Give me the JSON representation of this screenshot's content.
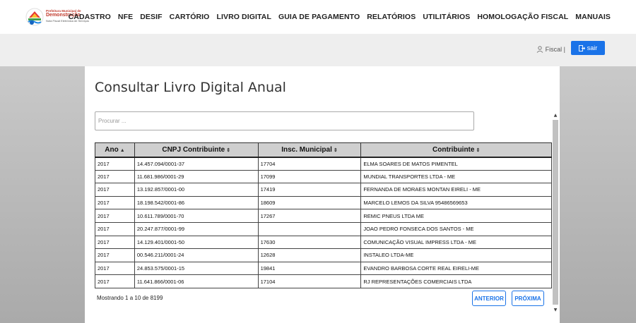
{
  "brand": {
    "line1": "Prefeitura Municipal de",
    "line2": "Demonstração",
    "line3": "Nota Fiscal Eletrônica de Serviços"
  },
  "nav": {
    "items": [
      "CADASTRO",
      "NFE",
      "DESIF",
      "CARTÓRIO",
      "LIVRO DIGITAL",
      "GUIA DE PAGAMENTO",
      "RELATÓRIOS",
      "UTILITÁRIOS",
      "HOMOLOGAÇÃO FISCAL",
      "MANUAIS"
    ]
  },
  "user": {
    "name": "Fiscal |",
    "logout_label": "sair"
  },
  "page": {
    "title": "Consultar Livro Digital Anual"
  },
  "search": {
    "placeholder": "Procurar ..."
  },
  "table": {
    "columns": [
      {
        "label": "Ano",
        "sort": "▲"
      },
      {
        "label": "CNPJ Contribuinte",
        "sort": "⇕"
      },
      {
        "label": "Insc. Municipal",
        "sort": "⇕"
      },
      {
        "label": "Contribuinte",
        "sort": "⇕"
      }
    ],
    "rows": [
      [
        "2017",
        "14.457.094/0001-37",
        "17704",
        "ELMA SOARES DE MATOS PIMENTEL"
      ],
      [
        "2017",
        "11.681.986/0001-29",
        "17099",
        "MUNDIAL TRANSPORTES LTDA - ME"
      ],
      [
        "2017",
        "13.192.857/0001-00",
        "17419",
        "FERNANDA DE MORAES MONTAN EIRELI - ME"
      ],
      [
        "2017",
        "18.198.542/0001-86",
        "18609",
        "MARCELO LEMOS DA SILVA 95486569653"
      ],
      [
        "2017",
        "10.611.789/0001-70",
        "17267",
        "REMIC PNEUS LTDA ME"
      ],
      [
        "2017",
        "20.247.877/0001-99",
        "",
        "JOAO PEDRO FONSECA DOS SANTOS - ME"
      ],
      [
        "2017",
        "14.129.401/0001-50",
        "17630",
        "COMUNICAÇÃO VISUAL IMPRESS LTDA - ME"
      ],
      [
        "2017",
        "00.546.211/0001-24",
        "12628",
        "INSTALEO LTDA-ME"
      ],
      [
        "2017",
        "24.853.575/0001-15",
        "19841",
        "EVANDRO BARBOSA CORTE REAL EIRELI-ME"
      ],
      [
        "2017",
        "11.641.866/0001-06",
        "17104",
        "RJ REPRESENTAÇÕES COMERCIAIS LTDA"
      ]
    ]
  },
  "pagination": {
    "info": "Mostrando 1 a 10 de 8199",
    "prev_label": "ANTERIOR",
    "next_label": "PRÓXIMA"
  },
  "colors": {
    "accent": "#1a73e8",
    "header_bg": "#cfcfcf"
  }
}
